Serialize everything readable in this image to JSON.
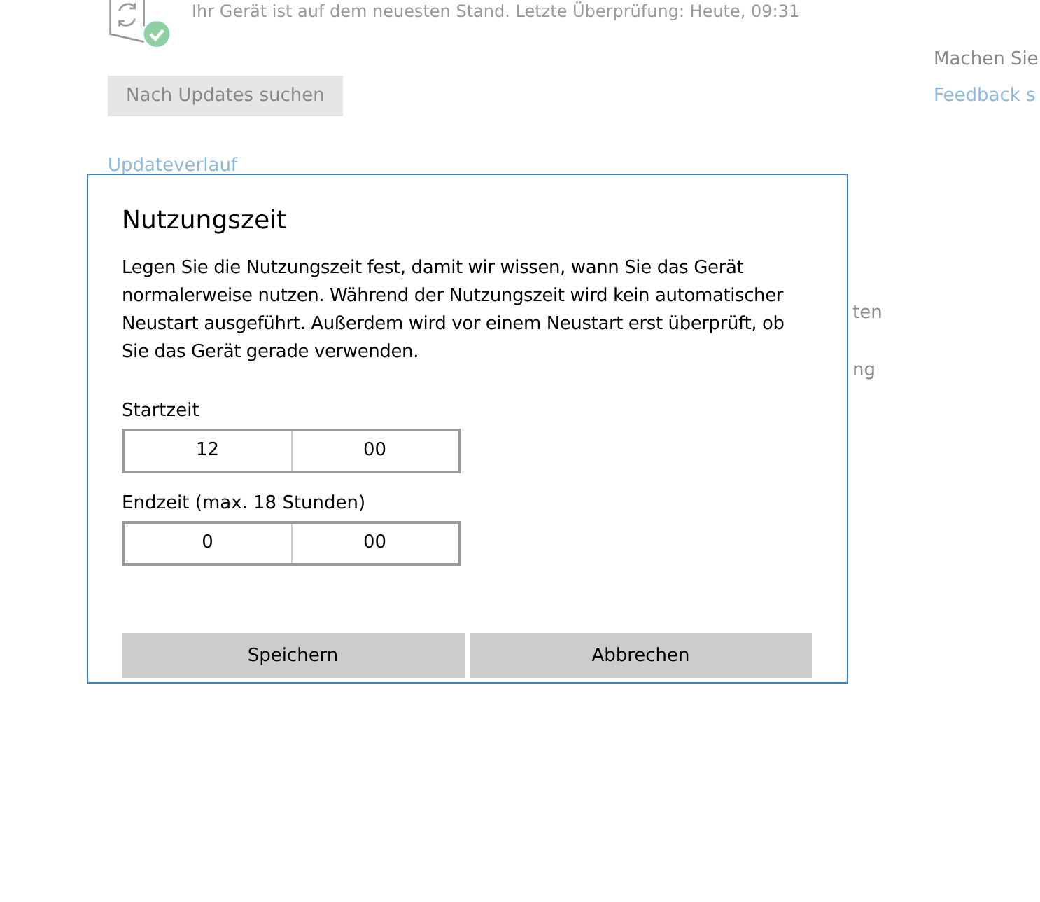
{
  "status": {
    "text": "Ihr Gerät ist auf dem neuesten Stand. Letzte Überprüfung: Heute, 09:31"
  },
  "check_button": {
    "label": "Nach Updates suchen"
  },
  "history_link": {
    "label": "Updateverlauf"
  },
  "side_panel": {
    "heading": "Machen Sie",
    "link": "Feedback s"
  },
  "hidden_fragments": [
    "ten",
    "ng"
  ],
  "dialog": {
    "title": "Nutzungszeit",
    "description": "Legen Sie die Nutzungszeit fest, damit wir wissen, wann Sie das Gerät normalerweise nutzen. Während der Nutzungszeit wird kein automatischer Neustart ausgeführt. Außerdem wird vor einem Neustart erst überprüft, ob Sie das Gerät gerade verwenden.",
    "fields": [
      {
        "label": "Startzeit",
        "hour": "12",
        "minute": "00"
      },
      {
        "label": "Endzeit (max. 18 Stunden)",
        "hour": "0",
        "minute": "00"
      }
    ],
    "buttons": [
      "Speichern",
      "Abbrechen"
    ]
  }
}
